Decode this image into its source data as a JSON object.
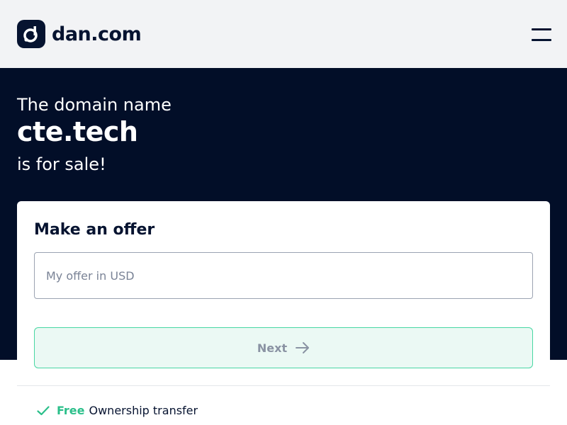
{
  "header": {
    "logo_text": "dan.com",
    "logo_icon": "dan-logo-icon",
    "menu_icon": "hamburger-menu-icon"
  },
  "hero": {
    "pre_text": "The domain name",
    "domain": "cte.tech",
    "post_text": "is for sale!"
  },
  "offer": {
    "title": "Make an offer",
    "input_placeholder": "My offer in USD",
    "input_value": "",
    "next_label": "Next",
    "next_icon": "arrow-right-icon"
  },
  "benefits": [
    {
      "highlight": "Free",
      "text": "Ownership transfer",
      "icon": "check-icon"
    }
  ],
  "colors": {
    "header_bg": "#f2f3f5",
    "hero_bg": "#020e28",
    "accent_green": "#2bbf8a",
    "text_dark": "#061330"
  }
}
